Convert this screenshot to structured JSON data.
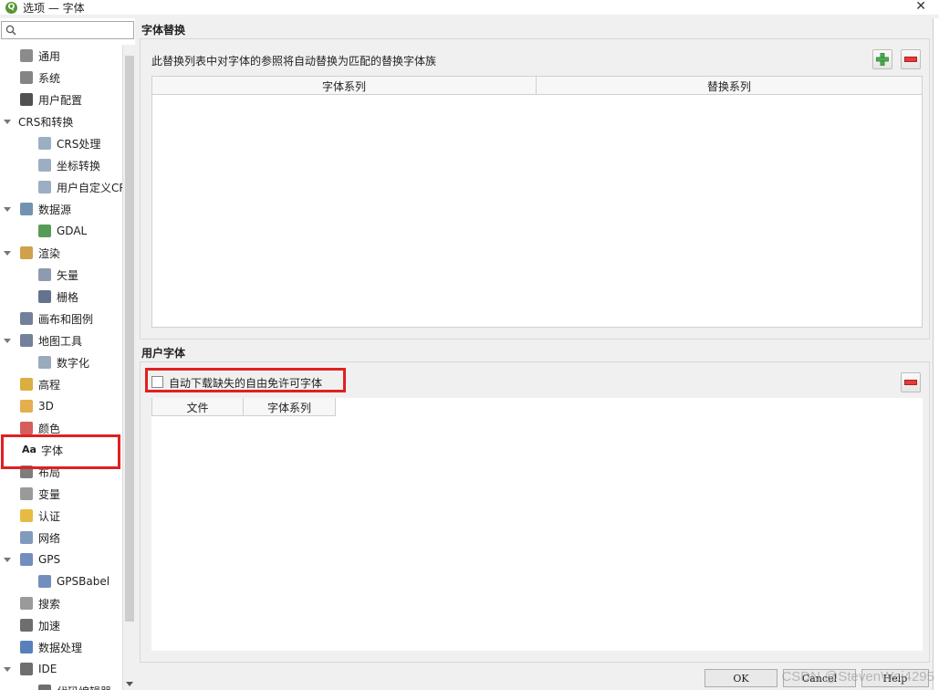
{
  "window": {
    "title": "选项 — 字体",
    "icon": "qgis-icon"
  },
  "sidebar": {
    "search_placeholder": "",
    "items": [
      {
        "label": "通用",
        "icon": "tools-icon",
        "color": "#777777",
        "level": 0
      },
      {
        "label": "系统",
        "icon": "gear-icon",
        "color": "#6f6f6f",
        "level": 0
      },
      {
        "label": "用户配置",
        "icon": "user-icon",
        "color": "#333333",
        "level": 0
      },
      {
        "label": "CRS和转换",
        "icon": "",
        "color": "",
        "level": 0,
        "expanded": true
      },
      {
        "label": "CRS处理",
        "icon": "globe-icon",
        "color": "#8aa0b8",
        "level": 1
      },
      {
        "label": "坐标转换",
        "icon": "globe-transform-icon",
        "color": "#8aa0b8",
        "level": 1
      },
      {
        "label": "用户自定义CR",
        "icon": "globe-user-icon",
        "color": "#8aa0b8",
        "level": 1
      },
      {
        "label": "数据源",
        "icon": "table-icon",
        "color": "#5b7fa5",
        "level": 0,
        "expanded": true
      },
      {
        "label": "GDAL",
        "icon": "gdal-icon",
        "color": "#3a8a3a",
        "level": 1
      },
      {
        "label": "渲染",
        "icon": "brush-icon",
        "color": "#c8902a",
        "level": 0,
        "expanded": true
      },
      {
        "label": "矢量",
        "icon": "vector-icon",
        "color": "#7a8aa0",
        "level": 1
      },
      {
        "label": "栅格",
        "icon": "raster-icon",
        "color": "#4a5a7a",
        "level": 1
      },
      {
        "label": "画布和图例",
        "icon": "canvas-icon",
        "color": "#5a6a8a",
        "level": 0
      },
      {
        "label": "地图工具",
        "icon": "map-tools-icon",
        "color": "#5a6a8a",
        "level": 0,
        "expanded": true
      },
      {
        "label": "数字化",
        "icon": "digitize-icon",
        "color": "#8a9ab0",
        "level": 1
      },
      {
        "label": "高程",
        "icon": "elevation-icon",
        "color": "#d4a020",
        "level": 0
      },
      {
        "label": "3D",
        "icon": "cube-icon",
        "color": "#e0a030",
        "level": 0
      },
      {
        "label": "颜色",
        "icon": "palette-icon",
        "color": "#d04040",
        "level": 0
      },
      {
        "label": "字体",
        "icon": "font-icon",
        "color": "#222222",
        "level": 0,
        "selected": true
      },
      {
        "label": "布局",
        "icon": "layout-icon",
        "color": "#666666",
        "level": 0
      },
      {
        "label": "变量",
        "icon": "variables-icon",
        "color": "#888888",
        "level": 0
      },
      {
        "label": "认证",
        "icon": "lock-icon",
        "color": "#e0b020",
        "level": 0
      },
      {
        "label": "网络",
        "icon": "network-icon",
        "color": "#6a8ab0",
        "level": 0
      },
      {
        "label": "GPS",
        "icon": "gps-icon",
        "color": "#5a7ab0",
        "level": 0,
        "expanded": true
      },
      {
        "label": "GPSBabel",
        "icon": "gps-icon",
        "color": "#5a7ab0",
        "level": 1
      },
      {
        "label": "搜索",
        "icon": "search-icon",
        "color": "#888888",
        "level": 0
      },
      {
        "label": "加速",
        "icon": "acceleration-icon",
        "color": "#555555",
        "level": 0
      },
      {
        "label": "数据处理",
        "icon": "processing-icon",
        "color": "#3a6ab0",
        "level": 0
      },
      {
        "label": "IDE",
        "icon": "ide-icon",
        "color": "#555555",
        "level": 0,
        "expanded": true
      },
      {
        "label": "代码编辑器",
        "icon": "code-editor-icon",
        "color": "#555555",
        "level": 1
      }
    ]
  },
  "font_substitutions": {
    "title": "字体替换",
    "description": "此替换列表中对字体的参照将自动替换为匹配的替换字体族",
    "columns": [
      "字体系列",
      "替换系列"
    ]
  },
  "user_fonts": {
    "title": "用户字体",
    "checkbox_label": "自动下载缺失的自由免许可字体",
    "checkbox_checked": false,
    "columns": [
      "文件",
      "字体系列"
    ]
  },
  "buttons": {
    "ok": "OK",
    "cancel": "Cancel",
    "help": "Help"
  },
  "watermark": "CSDN @StevenWei4295"
}
